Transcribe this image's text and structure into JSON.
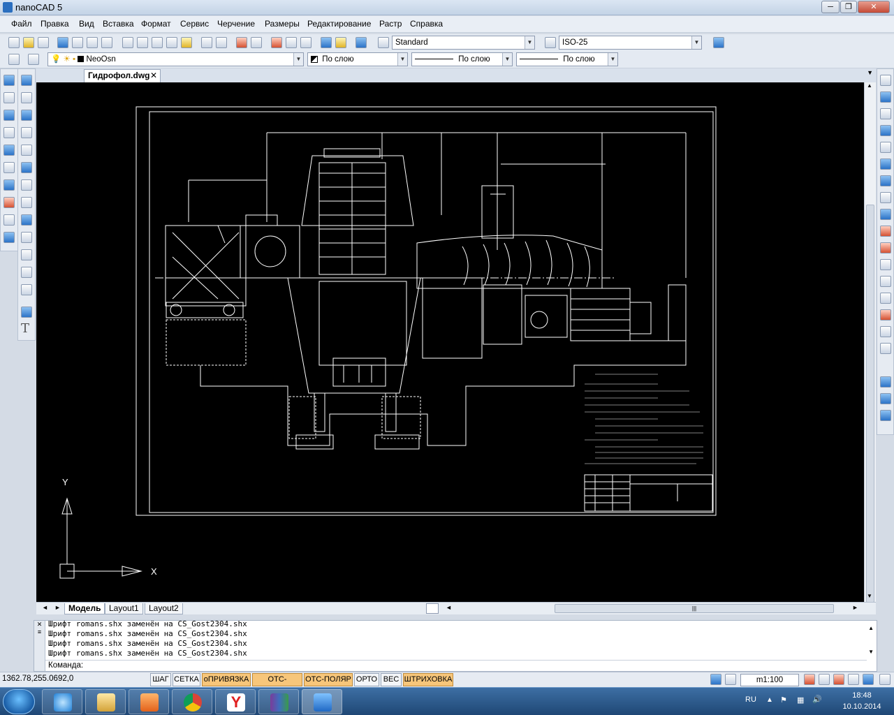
{
  "window": {
    "title": "nanoCAD 5",
    "controls": [
      "─",
      "❐",
      "✕"
    ]
  },
  "menu": [
    "Файл",
    "Правка",
    "Вид",
    "Вставка",
    "Формат",
    "Сервис",
    "Черчение",
    "Размеры",
    "Редактирование",
    "Растр",
    "Справка"
  ],
  "toolbar": {
    "text_style": "Standard",
    "dim_style": "ISO-25",
    "layer": "NeoOsn",
    "color": "По слою",
    "linetype": "По слою",
    "lineweight": "По слою"
  },
  "document": {
    "tab_label": "Гидрофол.dwg",
    "tab_close": "✕"
  },
  "ucs": {
    "y_label": "Y",
    "x_label": "X"
  },
  "layouts": [
    "Модель",
    "Layout1",
    "Layout2"
  ],
  "command": {
    "history": [
      "Шрифт romans.shx заменён на CS_Gost2304.shx",
      "Шрифт romans.shx заменён на CS_Gost2304.shx",
      "Шрифт romans.shx заменён на CS_Gost2304.shx",
      "Шрифт romans.shx заменён на CS_Gost2304.shx"
    ],
    "prompt": "Команда:"
  },
  "status": {
    "coords": "1362.78,255.0692,0",
    "toggles": [
      {
        "label": "ШАГ",
        "on": false
      },
      {
        "label": "СЕТКА",
        "on": false
      },
      {
        "label": "оПРИВЯЗКА",
        "on": true
      },
      {
        "label": "ОТС-ОБЪЕКТ",
        "on": true
      },
      {
        "label": "ОТС-ПОЛЯР",
        "on": true
      },
      {
        "label": "ОРТО",
        "on": false
      },
      {
        "label": "ВЕС",
        "on": false
      },
      {
        "label": "ШТРИХОВКА",
        "on": true
      }
    ],
    "scale": "m1:100"
  },
  "taskbar": {
    "lang": "RU",
    "time": "18:48",
    "date": "10.10.2014",
    "apps": [
      "internet-explorer-icon",
      "file-explorer-icon",
      "media-player-icon",
      "chrome-icon",
      "yandex-browser-icon",
      "winrar-icon",
      "nanocad-icon"
    ]
  },
  "colors": {
    "canvas": "#000000",
    "drawing": "#ffffff",
    "status_on": "#f7c67a",
    "taskbar": "#2a5688"
  }
}
